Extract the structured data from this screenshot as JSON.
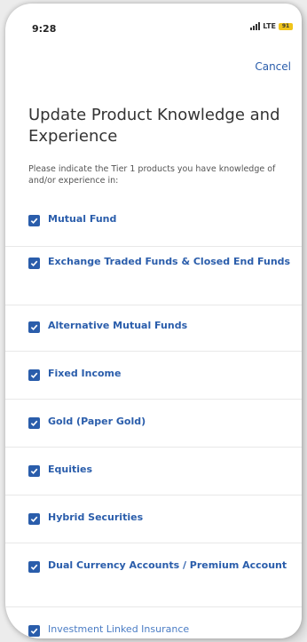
{
  "status": {
    "time": "9:28",
    "network": "LTE",
    "battery": "91"
  },
  "header": {
    "cancel_label": "Cancel"
  },
  "title": "Update Product Knowledge and Experience",
  "subtitle": "Please indicate the Tier 1 products you have knowledge of and/or experience in:",
  "products": [
    {
      "label": "Mutual Fund",
      "checked": true
    },
    {
      "label": "Exchange Traded Funds & Closed End Funds",
      "checked": true
    },
    {
      "label": "Alternative Mutual Funds",
      "checked": true
    },
    {
      "label": "Fixed Income",
      "checked": true
    },
    {
      "label": "Gold (Paper Gold)",
      "checked": true
    },
    {
      "label": "Equities",
      "checked": true
    },
    {
      "label": "Hybrid Securities",
      "checked": true
    },
    {
      "label": "Dual Currency Accounts / Premium Account",
      "checked": true
    },
    {
      "label": "Investment Linked Insurance",
      "checked": true
    }
  ],
  "colors": {
    "accent": "#2a5dab",
    "battery": "#f0c419"
  }
}
